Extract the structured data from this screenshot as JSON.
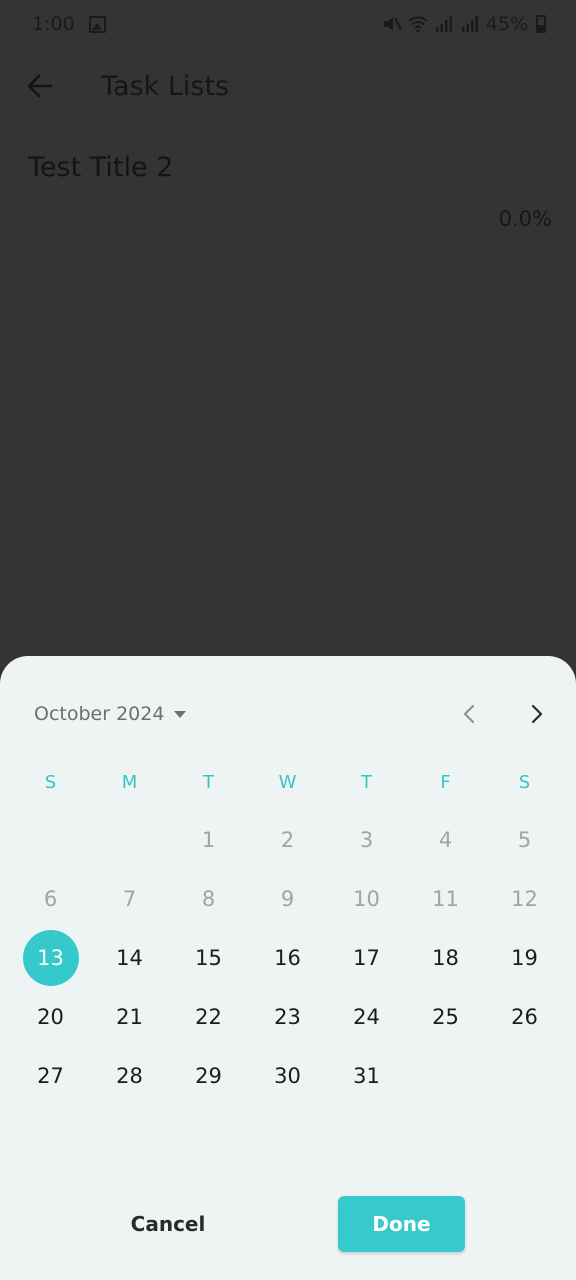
{
  "status_bar": {
    "time": "1:00",
    "battery": "45%"
  },
  "app_bar": {
    "title": "Task Lists"
  },
  "content": {
    "list_title": "Test Title 2",
    "progress": "0.0%"
  },
  "date_picker": {
    "month_label": "October 2024",
    "weekdays": [
      "S",
      "M",
      "T",
      "W",
      "T",
      "F",
      "S"
    ],
    "days": [
      {
        "label": "",
        "state": "empty"
      },
      {
        "label": "",
        "state": "empty"
      },
      {
        "label": "1",
        "state": "disabled"
      },
      {
        "label": "2",
        "state": "disabled"
      },
      {
        "label": "3",
        "state": "disabled"
      },
      {
        "label": "4",
        "state": "disabled"
      },
      {
        "label": "5",
        "state": "disabled"
      },
      {
        "label": "6",
        "state": "disabled"
      },
      {
        "label": "7",
        "state": "disabled"
      },
      {
        "label": "8",
        "state": "disabled"
      },
      {
        "label": "9",
        "state": "disabled"
      },
      {
        "label": "10",
        "state": "disabled"
      },
      {
        "label": "11",
        "state": "disabled"
      },
      {
        "label": "12",
        "state": "disabled"
      },
      {
        "label": "13",
        "state": "selected"
      },
      {
        "label": "14",
        "state": "enabled"
      },
      {
        "label": "15",
        "state": "enabled"
      },
      {
        "label": "16",
        "state": "enabled"
      },
      {
        "label": "17",
        "state": "enabled"
      },
      {
        "label": "18",
        "state": "enabled"
      },
      {
        "label": "19",
        "state": "enabled"
      },
      {
        "label": "20",
        "state": "enabled"
      },
      {
        "label": "21",
        "state": "enabled"
      },
      {
        "label": "22",
        "state": "enabled"
      },
      {
        "label": "23",
        "state": "enabled"
      },
      {
        "label": "24",
        "state": "enabled"
      },
      {
        "label": "25",
        "state": "enabled"
      },
      {
        "label": "26",
        "state": "enabled"
      },
      {
        "label": "27",
        "state": "enabled"
      },
      {
        "label": "28",
        "state": "enabled"
      },
      {
        "label": "29",
        "state": "enabled"
      },
      {
        "label": "30",
        "state": "enabled"
      },
      {
        "label": "31",
        "state": "enabled"
      }
    ],
    "cancel_label": "Cancel",
    "done_label": "Done"
  },
  "colors": {
    "accent": "#36c9cb",
    "scrim": "#343434",
    "sheet_background": "#eef4f3"
  },
  "icons": {
    "back": "arrow-left-icon",
    "prev": "chevron-left-icon",
    "next": "chevron-right-icon",
    "month_dropdown": "caret-down-icon"
  }
}
